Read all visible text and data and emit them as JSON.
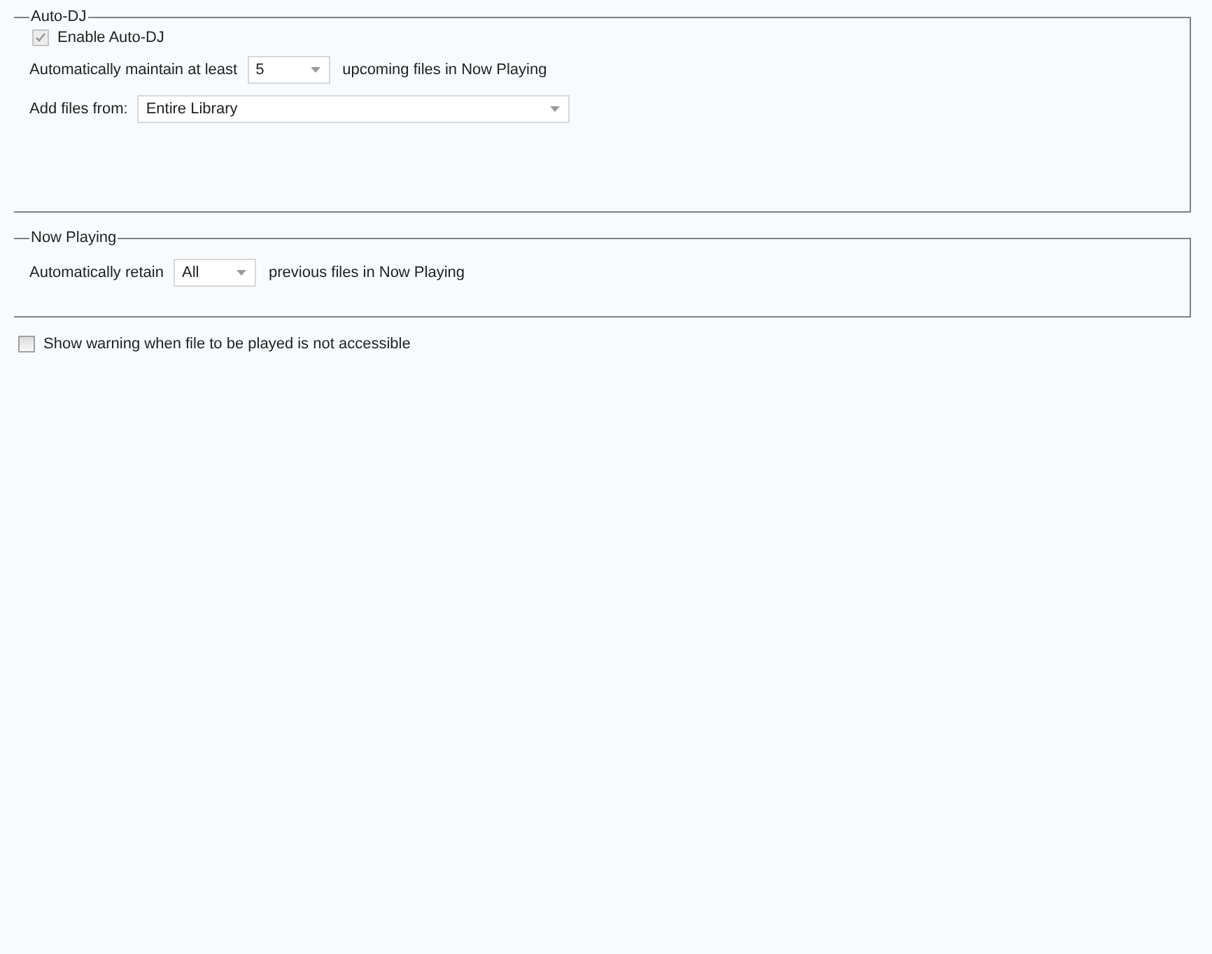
{
  "auto_dj": {
    "title": "Auto-DJ",
    "enable": {
      "label": "Enable Auto-DJ",
      "checked": true,
      "disabled": true
    },
    "maintain": {
      "label_before": "Automatically maintain at least",
      "value": "5",
      "label_after": "upcoming files in Now Playing"
    },
    "source": {
      "label": "Add files from:",
      "value": "Entire Library"
    }
  },
  "now_playing": {
    "title": "Now Playing",
    "retain": {
      "label_before": "Automatically retain",
      "value": "All",
      "label_after": "previous files in Now Playing"
    }
  },
  "show_warning": {
    "label": "Show warning when file to be played is not accessible",
    "checked": false,
    "disabled": false
  }
}
